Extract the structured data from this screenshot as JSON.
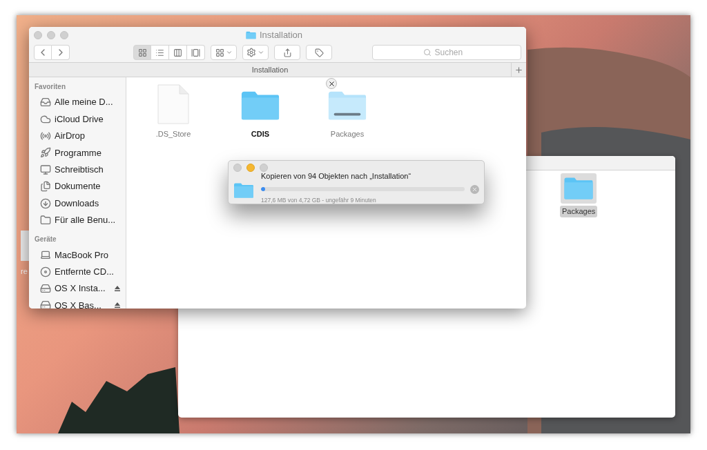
{
  "desktop": {
    "icons": [
      {
        "label": "re"
      }
    ]
  },
  "back_window": {
    "files": [
      {
        "name": "Packages",
        "selected": true
      }
    ]
  },
  "finder_window": {
    "title": "Installation",
    "path_bar": "Installation",
    "search": {
      "placeholder": "Suchen"
    },
    "view_modes": [
      {
        "kind": "icons",
        "selected": true
      },
      {
        "kind": "list",
        "selected": false
      },
      {
        "kind": "columns",
        "selected": false
      },
      {
        "kind": "coverflow",
        "selected": false
      }
    ],
    "sidebar": {
      "sections": [
        {
          "heading": "Favoriten",
          "items": [
            {
              "label": "Alle meine D...",
              "kind": "allfiles"
            },
            {
              "label": "iCloud Drive",
              "kind": "cloud"
            },
            {
              "label": "AirDrop",
              "kind": "airdrop"
            },
            {
              "label": "Programme",
              "kind": "apps"
            },
            {
              "label": "Schreibtisch",
              "kind": "desktop"
            },
            {
              "label": "Dokumente",
              "kind": "documents"
            },
            {
              "label": "Downloads",
              "kind": "downloads"
            },
            {
              "label": "Für alle Benu...",
              "kind": "folder"
            }
          ]
        },
        {
          "heading": "Geräte",
          "items": [
            {
              "label": "MacBook Pro",
              "kind": "laptop"
            },
            {
              "label": "Entfernte CD...",
              "kind": "disc"
            },
            {
              "label": "OS X Insta...",
              "kind": "volume"
            },
            {
              "label": "OS X Bas...",
              "kind": "volume"
            }
          ]
        }
      ]
    },
    "files": [
      {
        "name": ".DS_Store",
        "kind": "document"
      },
      {
        "name": "CDIS",
        "kind": "folder"
      },
      {
        "name": "Packages",
        "kind": "copying"
      }
    ]
  },
  "copy_dialog": {
    "message": "Kopieren von 94 Objekten nach „Installation“",
    "level": 0.02,
    "detail": "127,6 MB von 4,72 GB - ungefähr 9 Minuten"
  }
}
